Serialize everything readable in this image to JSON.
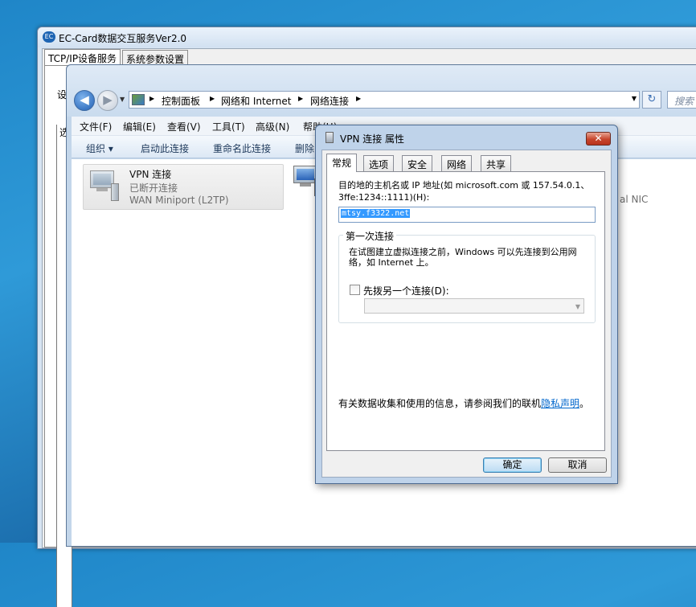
{
  "ec_window": {
    "title": "EC-Card数据交互服务Ver2.0",
    "app_icon_text": "EC",
    "tabs": [
      "TCP/IP设备服务",
      "系统参数设置"
    ],
    "side_label_1": "设",
    "side_label_2": "选"
  },
  "explorer": {
    "breadcrumbs": [
      "控制面板",
      "网络和 Internet",
      "网络连接"
    ],
    "search_placeholder": "搜索",
    "menu": [
      "文件(F)",
      "编辑(E)",
      "查看(V)",
      "工具(T)",
      "高级(N)",
      "帮助(H)"
    ],
    "commands": [
      "组织 ▾",
      "启动此连接",
      "重命名此连接",
      "删除"
    ],
    "connections": {
      "vpn": {
        "name": "VPN 连接",
        "status": "已断开连接",
        "device": "WAN Miniport (L2TP)"
      },
      "lan": {
        "device_tail": "al NIC"
      }
    }
  },
  "dialog": {
    "title": "VPN 连接 属性",
    "close_glyph": "✕",
    "tabs": [
      "常规",
      "选项",
      "安全",
      "网络",
      "共享"
    ],
    "host_label": "目的地的主机名或 IP 地址(如 microsoft.com 或 157.54.0.1、3ffe:1234::1111)(H):",
    "host_value": "mtsy.f3322.net",
    "first_conn_legend": "第一次连接",
    "first_conn_desc": "在试图建立虚拟连接之前，Windows 可以先连接到公用网络，如 Internet 上。",
    "predial_label": "先拨另一个连接(D):",
    "predial_value": "",
    "privacy_text": "有关数据收集和使用的信息，请参阅我们的联机",
    "privacy_link": "隐私声明",
    "privacy_end": "。",
    "ok_label": "确定",
    "cancel_label": "取消"
  }
}
